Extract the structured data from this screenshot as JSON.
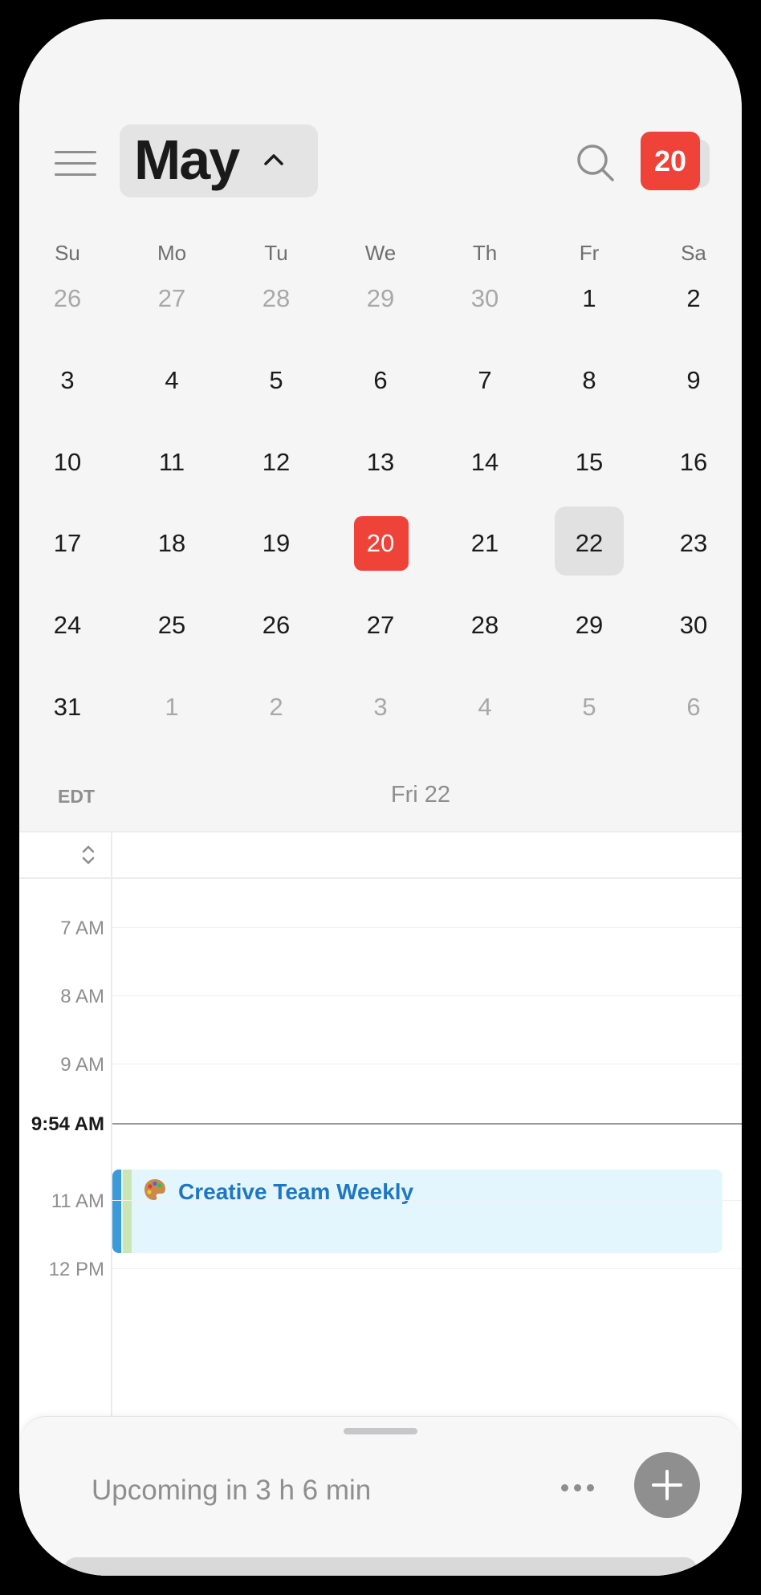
{
  "header": {
    "month": "May",
    "today_badge": "20"
  },
  "weekdays": [
    "Su",
    "Mo",
    "Tu",
    "We",
    "Th",
    "Fr",
    "Sa"
  ],
  "calendar": {
    "rows": [
      [
        {
          "d": "26",
          "muted": true
        },
        {
          "d": "27",
          "muted": true
        },
        {
          "d": "28",
          "muted": true
        },
        {
          "d": "29",
          "muted": true
        },
        {
          "d": "30",
          "muted": true
        },
        {
          "d": "1"
        },
        {
          "d": "2"
        }
      ],
      [
        {
          "d": "3"
        },
        {
          "d": "4"
        },
        {
          "d": "5"
        },
        {
          "d": "6"
        },
        {
          "d": "7"
        },
        {
          "d": "8"
        },
        {
          "d": "9"
        }
      ],
      [
        {
          "d": "10"
        },
        {
          "d": "11"
        },
        {
          "d": "12"
        },
        {
          "d": "13"
        },
        {
          "d": "14"
        },
        {
          "d": "15"
        },
        {
          "d": "16"
        }
      ],
      [
        {
          "d": "17"
        },
        {
          "d": "18"
        },
        {
          "d": "19"
        },
        {
          "d": "20",
          "today": true
        },
        {
          "d": "21"
        },
        {
          "d": "22",
          "selected": true
        },
        {
          "d": "23"
        }
      ],
      [
        {
          "d": "24"
        },
        {
          "d": "25"
        },
        {
          "d": "26"
        },
        {
          "d": "27"
        },
        {
          "d": "28"
        },
        {
          "d": "29"
        },
        {
          "d": "30"
        }
      ],
      [
        {
          "d": "31"
        },
        {
          "d": "1",
          "muted": true
        },
        {
          "d": "2",
          "muted": true
        },
        {
          "d": "3",
          "muted": true
        },
        {
          "d": "4",
          "muted": true
        },
        {
          "d": "5",
          "muted": true
        },
        {
          "d": "6",
          "muted": true
        }
      ]
    ]
  },
  "day_view": {
    "timezone": "EDT",
    "date_label": "Fri 22",
    "hours": [
      "7 AM",
      "8 AM",
      "9 AM",
      "11 AM",
      "12 PM"
    ],
    "now_label": "9:54 AM",
    "event": {
      "title": "Creative Team Weekly",
      "icon": "palette-icon"
    }
  },
  "bottom_sheet": {
    "upcoming_text": "Upcoming in 3 h 6 min"
  },
  "colors": {
    "accent_red": "#ef4339",
    "event_blue": "#3b9ad9",
    "event_green": "#cbe5b5",
    "event_bg": "#e3f6fd"
  }
}
